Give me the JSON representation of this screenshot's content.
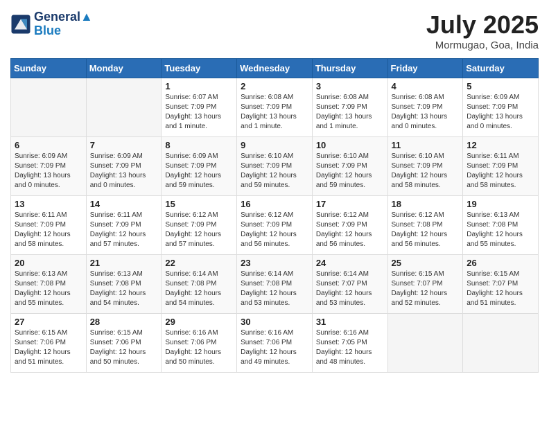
{
  "header": {
    "logo_line1": "General",
    "logo_line2": "Blue",
    "month": "July 2025",
    "location": "Mormugao, Goa, India"
  },
  "days_of_week": [
    "Sunday",
    "Monday",
    "Tuesday",
    "Wednesday",
    "Thursday",
    "Friday",
    "Saturday"
  ],
  "weeks": [
    [
      {
        "day": "",
        "info": ""
      },
      {
        "day": "",
        "info": ""
      },
      {
        "day": "1",
        "info": "Sunrise: 6:07 AM\nSunset: 7:09 PM\nDaylight: 13 hours and 1 minute."
      },
      {
        "day": "2",
        "info": "Sunrise: 6:08 AM\nSunset: 7:09 PM\nDaylight: 13 hours and 1 minute."
      },
      {
        "day": "3",
        "info": "Sunrise: 6:08 AM\nSunset: 7:09 PM\nDaylight: 13 hours and 1 minute."
      },
      {
        "day": "4",
        "info": "Sunrise: 6:08 AM\nSunset: 7:09 PM\nDaylight: 13 hours and 0 minutes."
      },
      {
        "day": "5",
        "info": "Sunrise: 6:09 AM\nSunset: 7:09 PM\nDaylight: 13 hours and 0 minutes."
      }
    ],
    [
      {
        "day": "6",
        "info": "Sunrise: 6:09 AM\nSunset: 7:09 PM\nDaylight: 13 hours and 0 minutes."
      },
      {
        "day": "7",
        "info": "Sunrise: 6:09 AM\nSunset: 7:09 PM\nDaylight: 13 hours and 0 minutes."
      },
      {
        "day": "8",
        "info": "Sunrise: 6:09 AM\nSunset: 7:09 PM\nDaylight: 12 hours and 59 minutes."
      },
      {
        "day": "9",
        "info": "Sunrise: 6:10 AM\nSunset: 7:09 PM\nDaylight: 12 hours and 59 minutes."
      },
      {
        "day": "10",
        "info": "Sunrise: 6:10 AM\nSunset: 7:09 PM\nDaylight: 12 hours and 59 minutes."
      },
      {
        "day": "11",
        "info": "Sunrise: 6:10 AM\nSunset: 7:09 PM\nDaylight: 12 hours and 58 minutes."
      },
      {
        "day": "12",
        "info": "Sunrise: 6:11 AM\nSunset: 7:09 PM\nDaylight: 12 hours and 58 minutes."
      }
    ],
    [
      {
        "day": "13",
        "info": "Sunrise: 6:11 AM\nSunset: 7:09 PM\nDaylight: 12 hours and 58 minutes."
      },
      {
        "day": "14",
        "info": "Sunrise: 6:11 AM\nSunset: 7:09 PM\nDaylight: 12 hours and 57 minutes."
      },
      {
        "day": "15",
        "info": "Sunrise: 6:12 AM\nSunset: 7:09 PM\nDaylight: 12 hours and 57 minutes."
      },
      {
        "day": "16",
        "info": "Sunrise: 6:12 AM\nSunset: 7:09 PM\nDaylight: 12 hours and 56 minutes."
      },
      {
        "day": "17",
        "info": "Sunrise: 6:12 AM\nSunset: 7:09 PM\nDaylight: 12 hours and 56 minutes."
      },
      {
        "day": "18",
        "info": "Sunrise: 6:12 AM\nSunset: 7:08 PM\nDaylight: 12 hours and 56 minutes."
      },
      {
        "day": "19",
        "info": "Sunrise: 6:13 AM\nSunset: 7:08 PM\nDaylight: 12 hours and 55 minutes."
      }
    ],
    [
      {
        "day": "20",
        "info": "Sunrise: 6:13 AM\nSunset: 7:08 PM\nDaylight: 12 hours and 55 minutes."
      },
      {
        "day": "21",
        "info": "Sunrise: 6:13 AM\nSunset: 7:08 PM\nDaylight: 12 hours and 54 minutes."
      },
      {
        "day": "22",
        "info": "Sunrise: 6:14 AM\nSunset: 7:08 PM\nDaylight: 12 hours and 54 minutes."
      },
      {
        "day": "23",
        "info": "Sunrise: 6:14 AM\nSunset: 7:08 PM\nDaylight: 12 hours and 53 minutes."
      },
      {
        "day": "24",
        "info": "Sunrise: 6:14 AM\nSunset: 7:07 PM\nDaylight: 12 hours and 53 minutes."
      },
      {
        "day": "25",
        "info": "Sunrise: 6:15 AM\nSunset: 7:07 PM\nDaylight: 12 hours and 52 minutes."
      },
      {
        "day": "26",
        "info": "Sunrise: 6:15 AM\nSunset: 7:07 PM\nDaylight: 12 hours and 51 minutes."
      }
    ],
    [
      {
        "day": "27",
        "info": "Sunrise: 6:15 AM\nSunset: 7:06 PM\nDaylight: 12 hours and 51 minutes."
      },
      {
        "day": "28",
        "info": "Sunrise: 6:15 AM\nSunset: 7:06 PM\nDaylight: 12 hours and 50 minutes."
      },
      {
        "day": "29",
        "info": "Sunrise: 6:16 AM\nSunset: 7:06 PM\nDaylight: 12 hours and 50 minutes."
      },
      {
        "day": "30",
        "info": "Sunrise: 6:16 AM\nSunset: 7:06 PM\nDaylight: 12 hours and 49 minutes."
      },
      {
        "day": "31",
        "info": "Sunrise: 6:16 AM\nSunset: 7:05 PM\nDaylight: 12 hours and 48 minutes."
      },
      {
        "day": "",
        "info": ""
      },
      {
        "day": "",
        "info": ""
      }
    ]
  ]
}
